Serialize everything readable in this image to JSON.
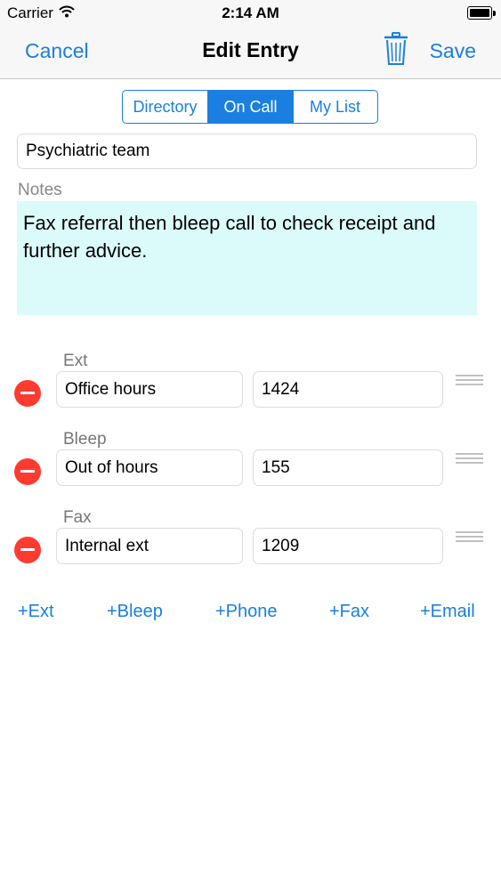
{
  "status_bar": {
    "carrier": "Carrier",
    "time": "2:14 AM"
  },
  "nav": {
    "cancel": "Cancel",
    "title": "Edit Entry",
    "save": "Save",
    "trash_icon": "trash-icon"
  },
  "segments": [
    {
      "label": "Directory",
      "selected": false
    },
    {
      "label": "On Call",
      "selected": true
    },
    {
      "label": "My List",
      "selected": false
    }
  ],
  "entry": {
    "name": "Psychiatric team",
    "notes_label": "Notes",
    "notes": "Fax referral then bleep call to check receipt and further advice."
  },
  "contacts": [
    {
      "type": "Ext",
      "label": "Office hours",
      "value": "1424"
    },
    {
      "type": "Bleep",
      "label": "Out of hours",
      "value": "155"
    },
    {
      "type": "Fax",
      "label": "Internal ext",
      "value": "1209"
    }
  ],
  "add_buttons": [
    "+Ext",
    "+Bleep",
    "+Phone",
    "+Fax",
    "+Email"
  ],
  "colors": {
    "accent": "#1a7fe0",
    "notes_bg": "#dbfbfb",
    "remove": "#ff3b30"
  }
}
